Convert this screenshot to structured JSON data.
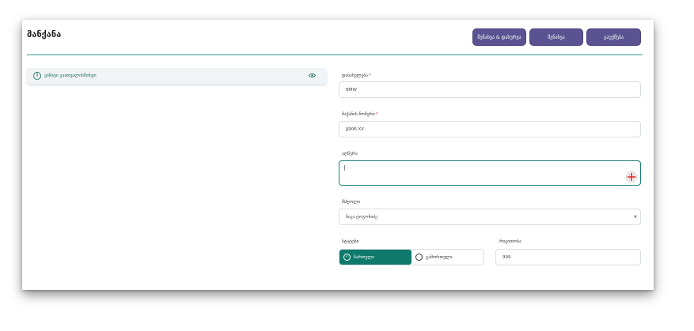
{
  "page": {
    "title": "მანქანა"
  },
  "toolbar": {
    "save_close_label": "შენახვა & დახურვა",
    "save_label": "შენახვა",
    "close_label": "გაუქმება"
  },
  "info_bar": {
    "text": "ვიზიტი გაითვალისწინეთ"
  },
  "form": {
    "name": {
      "label": "დასახელება",
      "required_mark": "*",
      "value": "BMW"
    },
    "plate": {
      "label": "მაქანის ნომერი",
      "required_mark": "*",
      "value": "JJ906 XX"
    },
    "description": {
      "label": "აღწერა",
      "value": ""
    },
    "driver": {
      "label": "მძღოლი",
      "value": "ნიკა ტოგონიძე",
      "chevron": "▼"
    },
    "status": {
      "label": "სტატუსი",
      "options": [
        "ჩართული",
        "გამორთული"
      ],
      "selected": "ჩართული"
    },
    "order": {
      "label": "რიგითობა",
      "value": "999"
    }
  },
  "colors": {
    "accent": "#0f7a6c",
    "button": "#5b5391",
    "divider": "#3f9b97",
    "required": "#dd3333"
  }
}
